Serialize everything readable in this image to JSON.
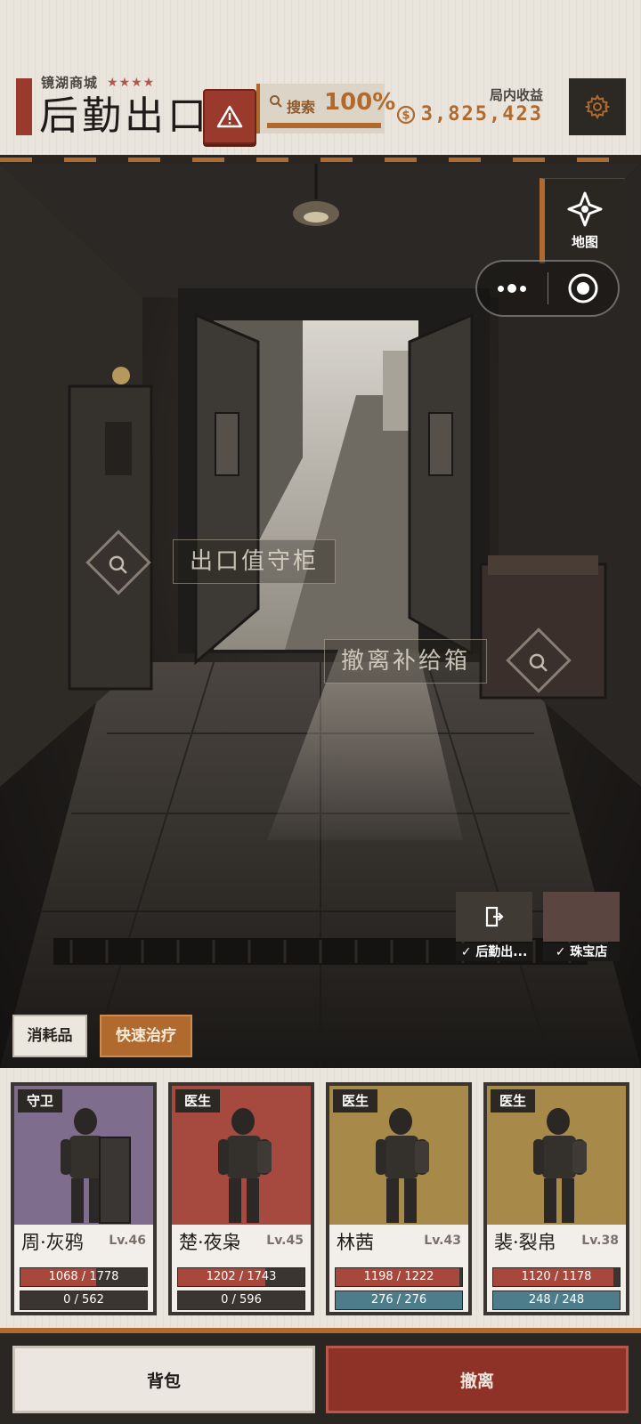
{
  "header": {
    "zone_name": "镜湖商城",
    "stars": "★★★★",
    "location_title": "后勤出口",
    "search": {
      "label": "搜索",
      "value": "100%",
      "progress": 1.0
    },
    "earnings": {
      "label": "局内收益",
      "value": "3,825,423"
    }
  },
  "overlay": {
    "map_label": "地图"
  },
  "scene": {
    "poi": [
      {
        "label": "出口值守柜"
      },
      {
        "label": "撤离补给箱"
      }
    ],
    "exits": [
      {
        "label": "后勤出..."
      },
      {
        "label": "珠宝店"
      }
    ],
    "actions": {
      "consumables": "消耗品",
      "quick_heal": "快速治疗"
    }
  },
  "squad": [
    {
      "role": "守卫",
      "name": "周·灰鸦",
      "level": "Lv.46",
      "hp": "1068 / 1778",
      "hp_ratio": 0.601,
      "mp": "0 / 562",
      "mp_ratio": 0,
      "bg": "#7e6d8c"
    },
    {
      "role": "医生",
      "name": "楚·夜枭",
      "level": "Lv.45",
      "hp": "1202 / 1743",
      "hp_ratio": 0.69,
      "mp": "0 / 596",
      "mp_ratio": 0,
      "bg": "#a64a40"
    },
    {
      "role": "医生",
      "name": "林茜",
      "level": "Lv.43",
      "hp": "1198 / 1222",
      "hp_ratio": 0.98,
      "mp": "276 / 276",
      "mp_ratio": 1,
      "bg": "#a78a4a"
    },
    {
      "role": "医生",
      "name": "裴·裂帛",
      "level": "Lv.38",
      "hp": "1120 / 1178",
      "hp_ratio": 0.951,
      "mp": "248 / 248",
      "mp_ratio": 1,
      "bg": "#a78a4a"
    }
  ],
  "bottom": {
    "bag": "背包",
    "evacuate": "撤离"
  },
  "colors": {
    "accent": "#b06a2e",
    "danger": "#9a3a2c",
    "hp": "#a8473b",
    "mp": "#4d7d8a"
  }
}
